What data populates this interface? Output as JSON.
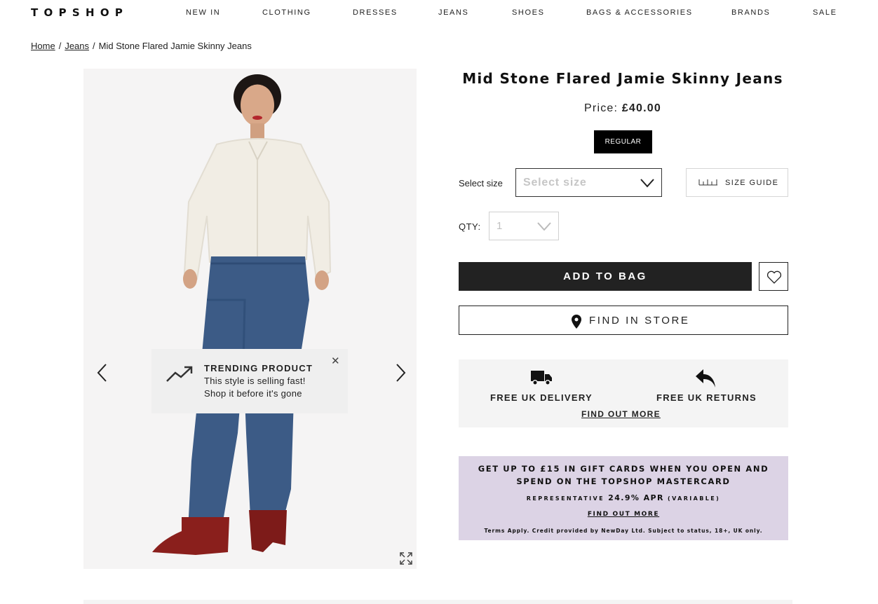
{
  "header": {
    "logo": "TOPSHOP",
    "nav": [
      "NEW IN",
      "CLOTHING",
      "DRESSES",
      "JEANS",
      "SHOES",
      "BAGS & ACCESSORIES",
      "BRANDS",
      "SALE"
    ]
  },
  "breadcrumb": {
    "home": "Home",
    "sep": "/",
    "category": "Jeans",
    "current": "Mid Stone Flared Jamie Skinny Jeans"
  },
  "gallery": {
    "prev_icon": "chevron-left-icon",
    "next_icon": "chevron-right-icon",
    "expand_icon": "expand-icon"
  },
  "trending": {
    "title": "TRENDING PRODUCT",
    "line1": "This style is selling fast!",
    "line2": "Shop it before it's gone",
    "close": "✕"
  },
  "product": {
    "title": "Mid Stone Flared Jamie Skinny Jeans",
    "price_label": "Price:",
    "price": "£40.00",
    "fit": "REGULAR",
    "size_label": "Select size",
    "size_placeholder": "Select size",
    "size_guide": "SIZE GUIDE",
    "qty_label": "QTY:",
    "qty_value": "1",
    "add_to_bag": "ADD TO BAG",
    "find_in_store": "FIND IN STORE"
  },
  "delivery": {
    "delivery_text": "FREE UK DELIVERY",
    "returns_text": "FREE UK RETURNS",
    "find_out_more": "FIND OUT MORE"
  },
  "promo": {
    "line1a": "GET UP TO £15 IN GIFT CARDS WHEN YOU OPEN AND",
    "line1b": "SPEND ON THE TOPSHOP MASTERCARD",
    "rep_label": "REPRESENTATIVE",
    "apr": "24.9% APR",
    "variable": "(VARIABLE)",
    "find_out_more": "FIND OUT MORE",
    "terms": "Terms Apply. Credit provided by NewDay Ltd. Subject to status, 18+, UK only."
  },
  "colors": {
    "brand": "#111111",
    "button_dark": "#222222",
    "promo_bg": "#dcd3e5",
    "panel_bg": "#f4f4f4"
  }
}
